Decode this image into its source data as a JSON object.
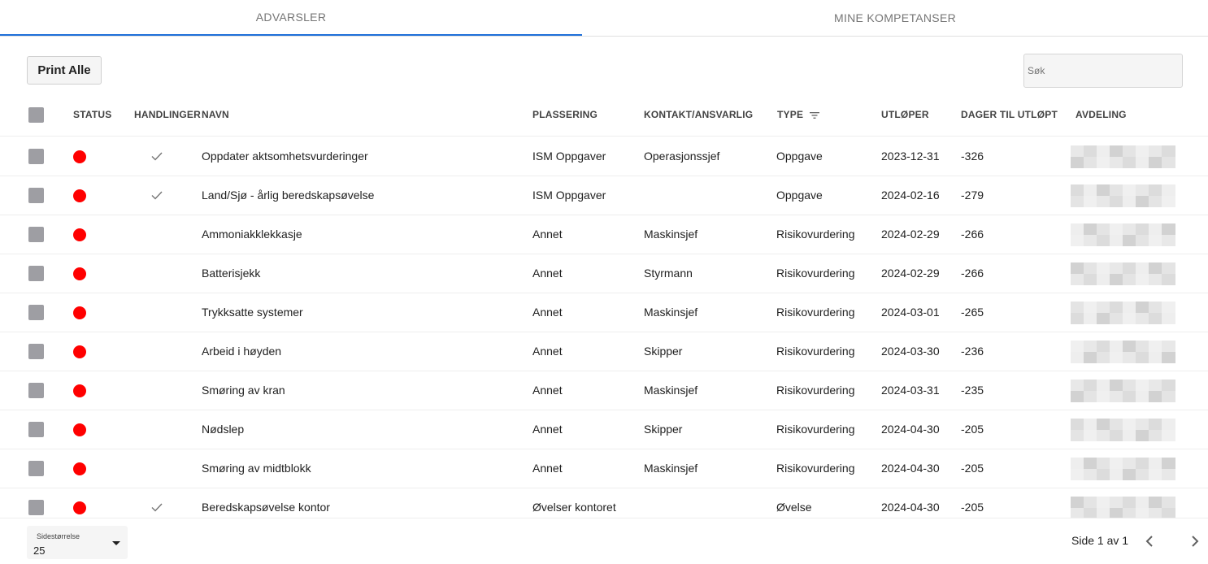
{
  "tabs": [
    {
      "label": "ADVARSLER",
      "active": true
    },
    {
      "label": "MINE KOMPETANSER",
      "active": false
    }
  ],
  "toolbar": {
    "print_label": "Print Alle",
    "search_placeholder": "Søk"
  },
  "table": {
    "headers": {
      "status": "STATUS",
      "handlinger": "HANDLINGER",
      "navn": "NAVN",
      "plassering": "PLASSERING",
      "kontakt": "KONTAKT/ANSVARLIG",
      "type": "TYPE",
      "utloper": "UTLØPER",
      "dager": "DAGER TIL UTLØPT",
      "avdeling": "AVDELING"
    },
    "rows": [
      {
        "status": "red",
        "action": true,
        "navn": "Oppdater aktsomhetsvurderinger",
        "plassering": "ISM Oppgaver",
        "kontakt": "Operasjonssjef",
        "type": "Oppgave",
        "utloper": "2023-12-31",
        "dager": "-326"
      },
      {
        "status": "red",
        "action": true,
        "navn": "Land/Sjø - årlig beredskapsøvelse",
        "plassering": "ISM Oppgaver",
        "kontakt": "",
        "type": "Oppgave",
        "utloper": "2024-02-16",
        "dager": "-279"
      },
      {
        "status": "red",
        "action": false,
        "navn": "Ammoniakklekkasje",
        "plassering": "Annet",
        "kontakt": "Maskinsjef",
        "type": "Risikovurdering",
        "utloper": "2024-02-29",
        "dager": "-266"
      },
      {
        "status": "red",
        "action": false,
        "navn": "Batterisjekk",
        "plassering": "Annet",
        "kontakt": "Styrmann",
        "type": "Risikovurdering",
        "utloper": "2024-02-29",
        "dager": "-266"
      },
      {
        "status": "red",
        "action": false,
        "navn": "Trykksatte systemer",
        "plassering": "Annet",
        "kontakt": "Maskinsjef",
        "type": "Risikovurdering",
        "utloper": "2024-03-01",
        "dager": "-265"
      },
      {
        "status": "red",
        "action": false,
        "navn": "Arbeid i høyden",
        "plassering": "Annet",
        "kontakt": "Skipper",
        "type": "Risikovurdering",
        "utloper": "2024-03-30",
        "dager": "-236"
      },
      {
        "status": "red",
        "action": false,
        "navn": "Smøring av kran",
        "plassering": "Annet",
        "kontakt": "Maskinsjef",
        "type": "Risikovurdering",
        "utloper": "2024-03-31",
        "dager": "-235"
      },
      {
        "status": "red",
        "action": false,
        "navn": "Nødslep",
        "plassering": "Annet",
        "kontakt": "Skipper",
        "type": "Risikovurdering",
        "utloper": "2024-04-30",
        "dager": "-205"
      },
      {
        "status": "red",
        "action": false,
        "navn": "Smøring av midtblokk",
        "plassering": "Annet",
        "kontakt": "Maskinsjef",
        "type": "Risikovurdering",
        "utloper": "2024-04-30",
        "dager": "-205"
      },
      {
        "status": "red",
        "action": true,
        "navn": "Beredskapsøvelse kontor",
        "plassering": "Øvelser kontoret",
        "kontakt": "",
        "type": "Øvelse",
        "utloper": "2024-04-30",
        "dager": "-205"
      }
    ]
  },
  "footer": {
    "pagesize_label": "Sidestørrelse",
    "pagesize_value": "25",
    "page_info": "Side 1 av 1"
  },
  "colors": {
    "accent": "#1e6fd9",
    "status_red": "#ff0000",
    "checkbox": "#9e9ea3"
  }
}
